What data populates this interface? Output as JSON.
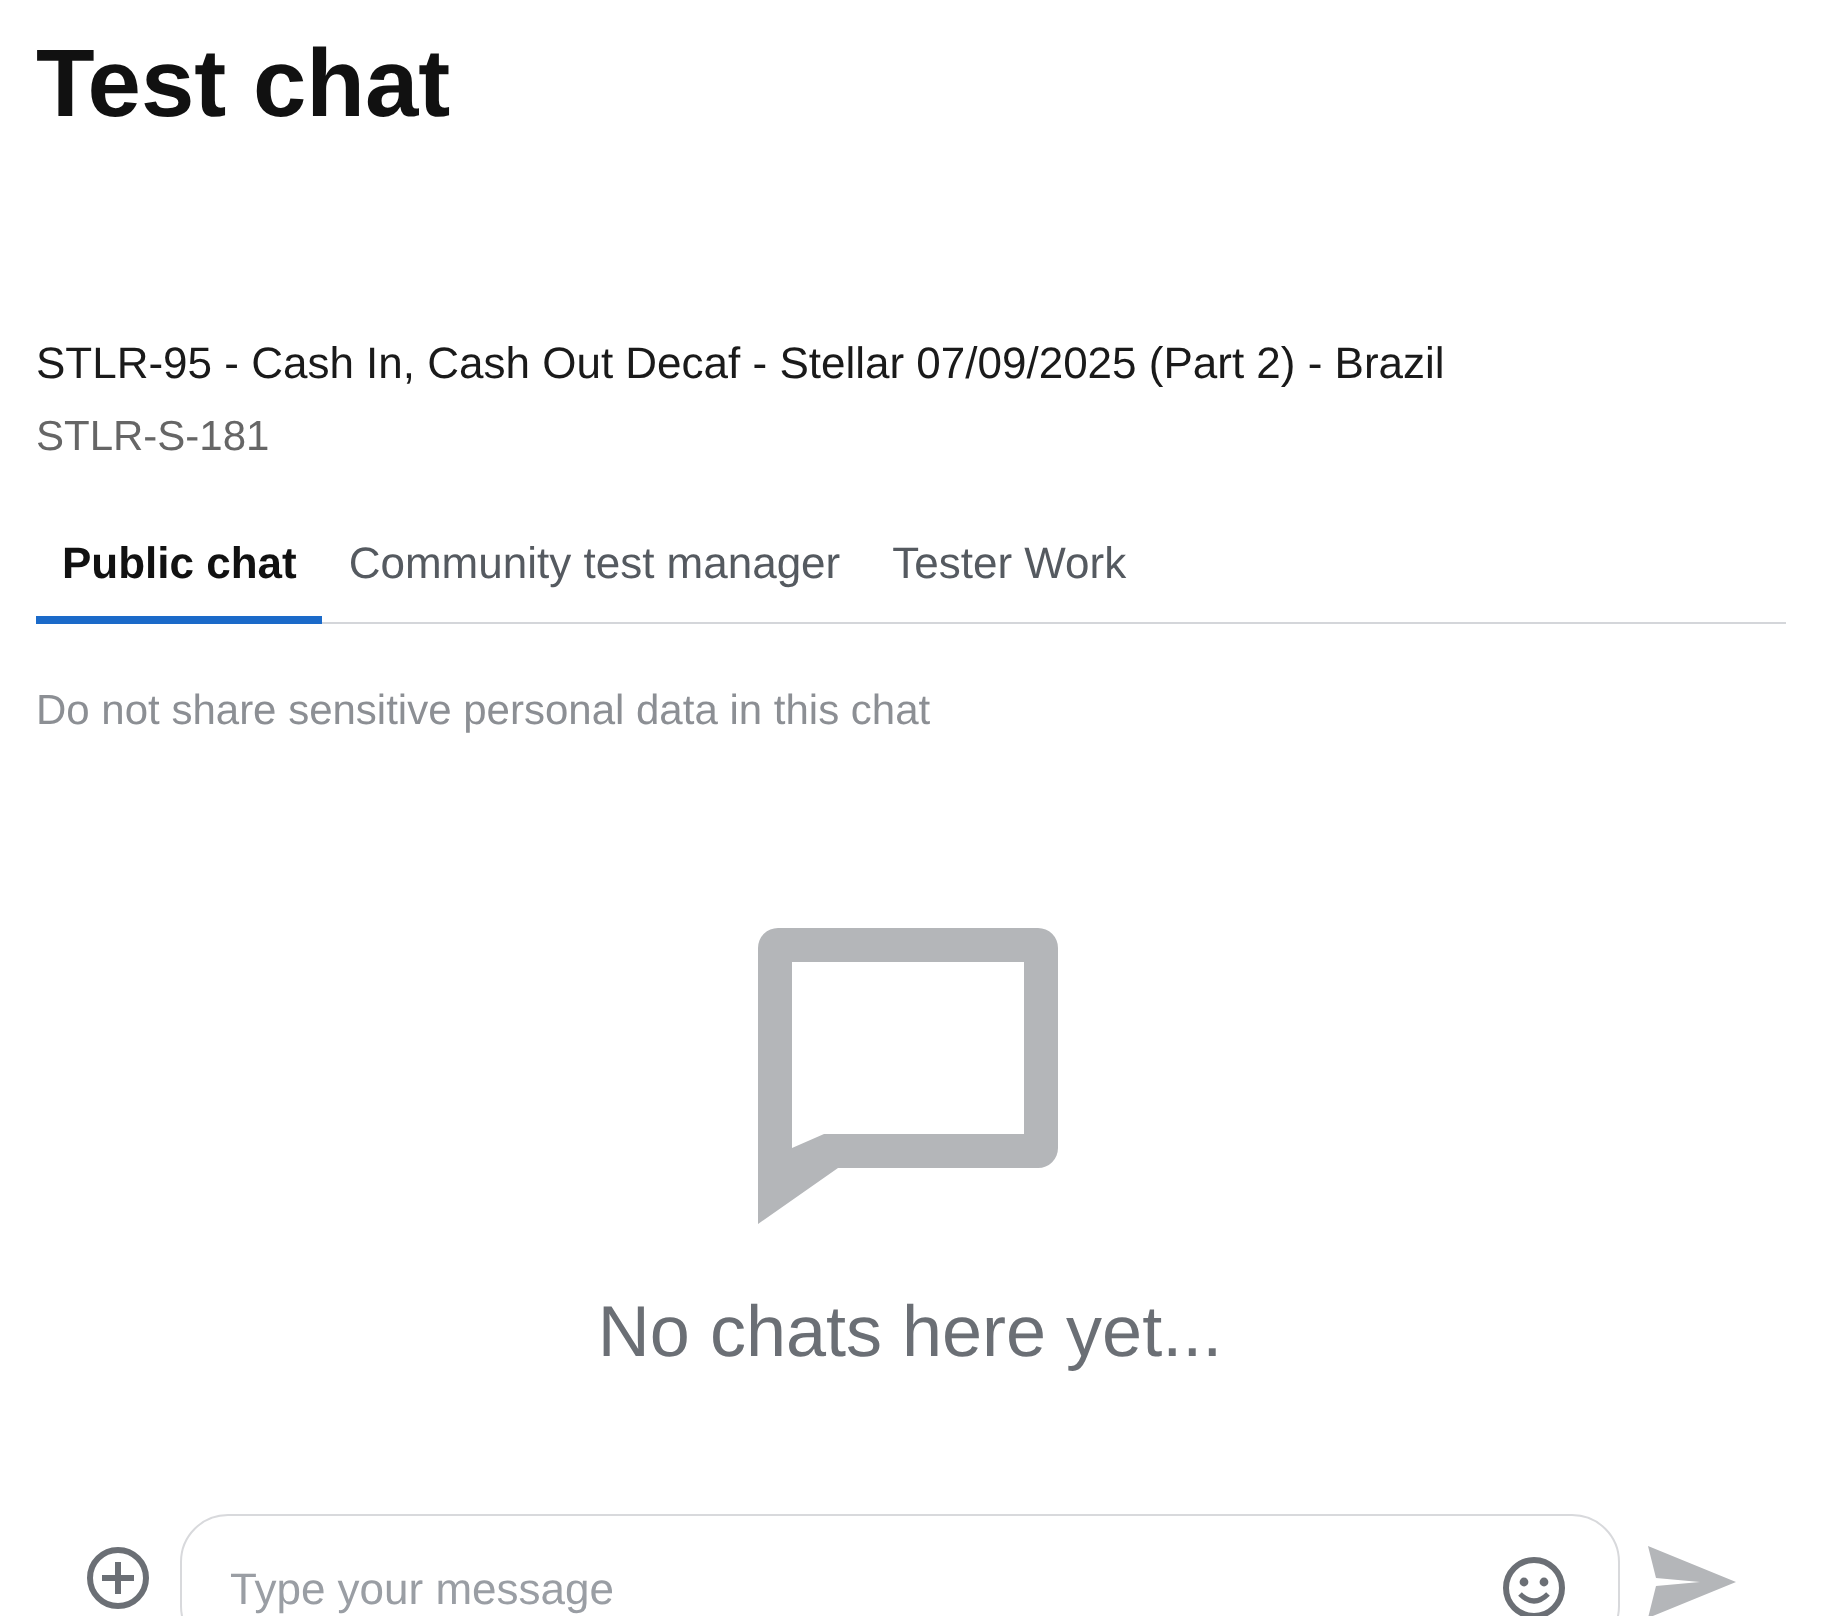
{
  "page": {
    "title": "Test chat"
  },
  "test": {
    "name": "STLR-95 - Cash In, Cash Out Decaf - Stellar 07/09/2025 (Part 2) - Brazil",
    "code": "STLR-S-181"
  },
  "tabs": [
    {
      "label": "Public chat",
      "selected": true
    },
    {
      "label": "Community test manager",
      "selected": false
    },
    {
      "label": "Tester Work",
      "selected": false
    }
  ],
  "notice": "Do not share sensitive personal data in this chat",
  "empty_state": "No chats here yet...",
  "composer": {
    "placeholder": "Type your message"
  }
}
